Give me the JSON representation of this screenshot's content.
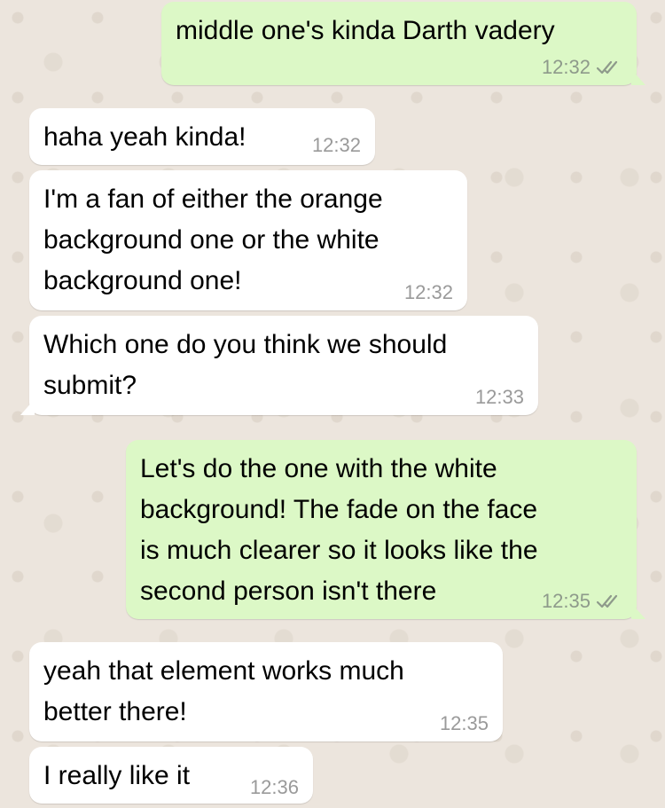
{
  "colors": {
    "background": "#ECE5DD",
    "incoming_bubble": "#FFFFFF",
    "outgoing_bubble": "#DCF8C6",
    "read_ticks": "#8E9A8B"
  },
  "messages": [
    {
      "direction": "outgoing",
      "lines": [
        "middle one's kinda Darth vadery"
      ],
      "time": "12:32",
      "status_icon": "double-check-icon"
    },
    {
      "direction": "incoming",
      "lines": [
        "haha yeah kinda!"
      ],
      "time": "12:32"
    },
    {
      "direction": "incoming",
      "lines": [
        "I'm a fan of either the orange",
        "background one or the white",
        "background one!"
      ],
      "time": "12:32"
    },
    {
      "direction": "incoming",
      "lines": [
        "Which one do you think we should",
        "submit?"
      ],
      "time": "12:33"
    },
    {
      "direction": "outgoing",
      "lines": [
        "Let's do the one with the white",
        "background! The fade on the face",
        "is much clearer so it looks like the",
        "second person isn't there"
      ],
      "time": "12:35",
      "status_icon": "double-check-icon"
    },
    {
      "direction": "incoming",
      "lines": [
        "yeah that element works much",
        "better there!"
      ],
      "time": "12:35"
    },
    {
      "direction": "incoming",
      "lines": [
        "I really like it"
      ],
      "time": "12:36"
    }
  ]
}
